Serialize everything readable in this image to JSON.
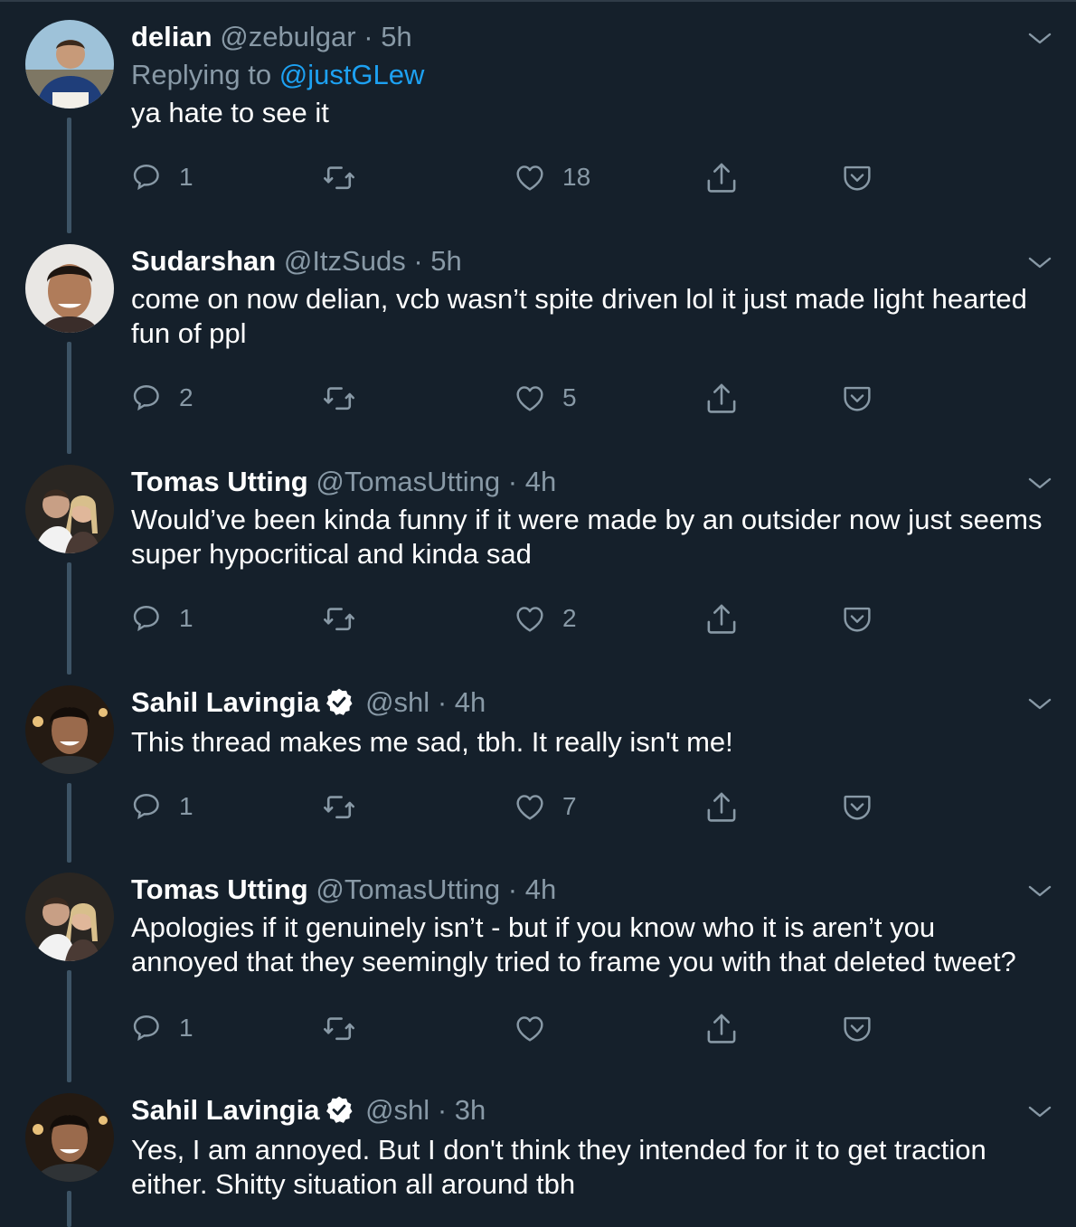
{
  "colors": {
    "background": "#15202b",
    "muted": "#8899a6",
    "accent": "#1da1f2",
    "thread": "#3d5466",
    "verified": "#ffffff"
  },
  "icons": [
    "reply-icon",
    "retweet-icon",
    "like-icon",
    "share-icon",
    "save-icon",
    "chevron-down-icon",
    "verified-badge-icon"
  ],
  "tweets": [
    {
      "name": "delian",
      "handle": "@zebulgar",
      "dot": "·",
      "time": "5h",
      "replying_prefix": "Replying to",
      "replying_to": "@justGLew",
      "text_lines": [
        "ya hate to see it"
      ],
      "reply_count": "1",
      "retweet_count": "",
      "like_count": "18",
      "verified": false
    },
    {
      "name": "Sudarshan",
      "handle": "@ItzSuds",
      "dot": "·",
      "time": "5h",
      "text_lines": [
        "come on now delian, vcb wasn’t spite driven lol it just made light hearted",
        "fun of ppl"
      ],
      "reply_count": "2",
      "retweet_count": "",
      "like_count": "5",
      "verified": false
    },
    {
      "name": "Tomas Utting",
      "handle": "@TomasUtting",
      "dot": "·",
      "time": "4h",
      "text_lines": [
        "Would’ve been kinda funny if it were made by an outsider now just seems",
        "super hypocritical and kinda sad"
      ],
      "reply_count": "1",
      "retweet_count": "",
      "like_count": "2",
      "verified": false
    },
    {
      "name": "Sahil Lavingia",
      "handle": "@shl",
      "dot": "·",
      "time": "4h",
      "text_lines": [
        "This thread makes me sad, tbh. It really isn't me!"
      ],
      "reply_count": "1",
      "retweet_count": "",
      "like_count": "7",
      "verified": true
    },
    {
      "name": "Tomas Utting",
      "handle": "@TomasUtting",
      "dot": "·",
      "time": "4h",
      "text_lines": [
        "Apologies if it genuinely isn’t - but if you know who it is aren’t you",
        "annoyed that they seemingly tried to frame you with that deleted tweet?"
      ],
      "reply_count": "1",
      "retweet_count": "",
      "like_count": "",
      "verified": false
    },
    {
      "name": "Sahil Lavingia",
      "handle": "@shl",
      "dot": "·",
      "time": "3h",
      "text_lines": [
        "Yes, I am annoyed. But I don't think they intended for it to get traction",
        "either. Shitty situation all around tbh"
      ],
      "verified": true
    }
  ]
}
